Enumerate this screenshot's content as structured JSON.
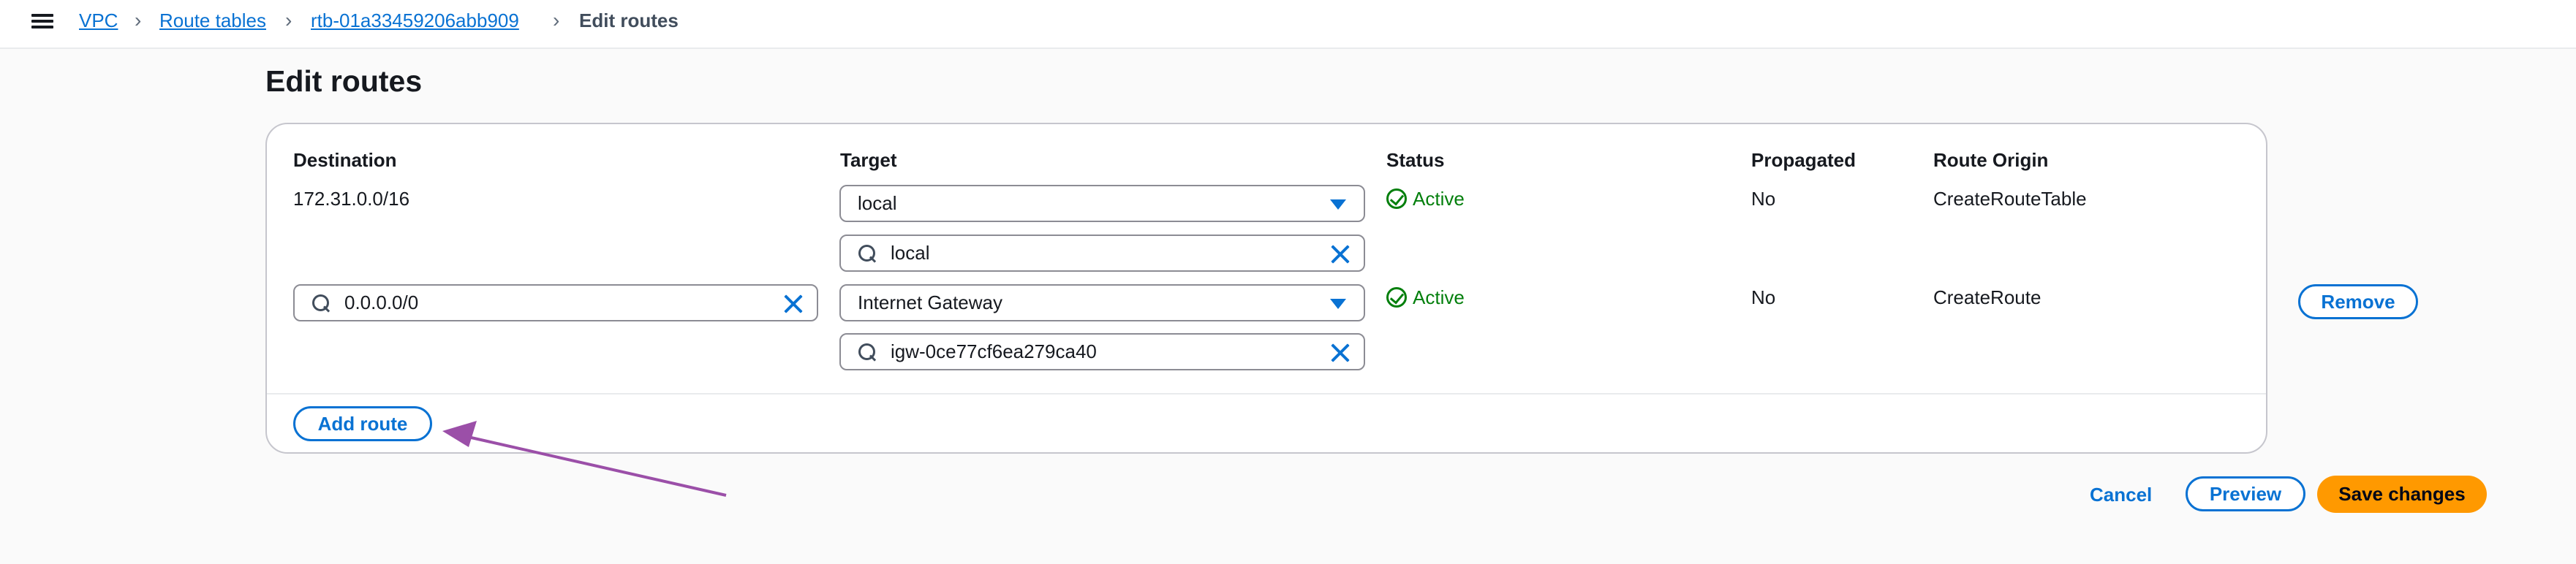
{
  "breadcrumb": {
    "items": [
      "VPC",
      "Route tables",
      "rtb-01a33459206abb909"
    ],
    "current": "Edit routes"
  },
  "page_title": "Edit routes",
  "columns": {
    "destination": "Destination",
    "target": "Target",
    "status": "Status",
    "propagated": "Propagated",
    "route_origin": "Route Origin"
  },
  "routes": [
    {
      "destination": "172.31.0.0/16",
      "target_type": "local",
      "target_value": "local",
      "status": "Active",
      "propagated": "No",
      "route_origin": "CreateRouteTable"
    },
    {
      "destination": "0.0.0.0/0",
      "target_type": "Internet Gateway",
      "target_value": "igw-0ce77cf6ea279ca40",
      "status": "Active",
      "propagated": "No",
      "route_origin": "CreateRoute",
      "remove_label": "Remove"
    }
  ],
  "add_route_label": "Add route",
  "actions": {
    "cancel": "Cancel",
    "preview": "Preview",
    "save": "Save changes"
  },
  "colors": {
    "link": "#0972d3",
    "active": "#037f0c",
    "primary": "#ff9900",
    "annotation_arrow": "#9b4fa8"
  }
}
